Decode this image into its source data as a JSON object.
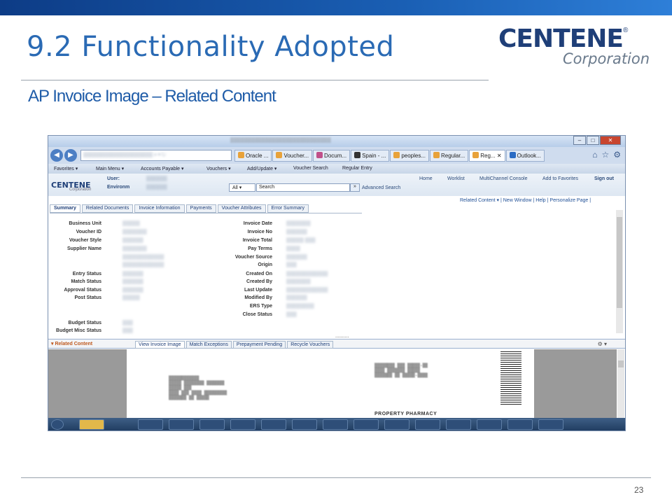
{
  "slide": {
    "title": "9.2 Functionality Adopted",
    "subtitle": "AP Invoice Image – Related Content",
    "page_number": "23",
    "logo": {
      "brand": "CENTENE",
      "reg": "®",
      "corp": "Corporation"
    }
  },
  "browser": {
    "window_buttons": [
      "–",
      "□",
      "✕"
    ],
    "tabs": [
      {
        "label": "Oracle ...",
        "icon": "ie-icon",
        "color": "#e8a23a"
      },
      {
        "label": "Voucher...",
        "icon": "ie-icon",
        "color": "#e8a23a"
      },
      {
        "label": "Docum...",
        "icon": "doc-icon",
        "color": "#c0508a"
      },
      {
        "label": "Spain - ...",
        "icon": "wikipedia-icon",
        "color": "#333333"
      },
      {
        "label": "peoples...",
        "icon": "ie-icon",
        "color": "#e8a23a"
      },
      {
        "label": "Regular...",
        "icon": "ie-icon",
        "color": "#e8a23a"
      },
      {
        "label": "Reg...",
        "icon": "ie-icon",
        "color": "#e8a23a",
        "active": true
      },
      {
        "label": "Outlook...",
        "icon": "outlook-icon",
        "color": "#2b6cc4"
      }
    ]
  },
  "app": {
    "menu": [
      "Favorites ▾",
      "Main Menu ▾",
      "Accounts Payable ▾",
      "Vouchers ▾",
      "Add/Update ▾",
      "Voucher Search",
      "Regular Entry"
    ],
    "header": {
      "logo": "CENTENE",
      "logo_sub": "Corporation",
      "user_label": "User:",
      "env_label": "Environm",
      "select_value": "All",
      "search_placeholder": "Search",
      "go": "»",
      "advanced_search": "Advanced Search",
      "links": [
        "Home",
        "Worklist",
        "MultiChannel Console",
        "Add to Favorites",
        "Sign out"
      ]
    },
    "related_links": "Related Content ▾  |  New Window  |  Help  |  Personalize Page  |",
    "subtabs": [
      "Summary",
      "Related Documents",
      "Invoice Information",
      "Payments",
      "Voucher Attributes",
      "Error Summary"
    ],
    "left_fields": [
      "Business Unit",
      "Voucher ID",
      "Voucher Style",
      "Supplier Name",
      "Entry Status",
      "Match Status",
      "Approval Status",
      "Post Status",
      "Budget Status",
      "Budget Misc Status"
    ],
    "right_fields": [
      "Invoice Date",
      "Invoice No",
      "Invoice Total",
      "Pay Terms",
      "Voucher Source",
      "Origin",
      "Created On",
      "Created By",
      "Last Update",
      "Modified By",
      "ERS Type",
      "Close Status"
    ],
    "more_dots": "..........",
    "related_content": {
      "title": "Related Content",
      "tabs": [
        "View Invoice Image",
        "Match Exceptions",
        "Prepayment Pending",
        "Recycle Vouchers"
      ],
      "gear": "⚙ ▾",
      "doc_partial_text": "PROPERTY PHARMACY"
    }
  }
}
